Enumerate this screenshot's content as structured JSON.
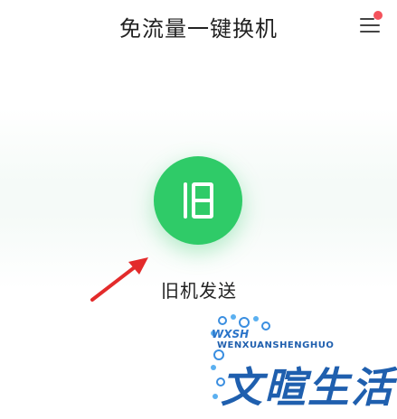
{
  "header": {
    "title": "免流量一键换机"
  },
  "menu": {
    "icon": "menu-icon",
    "badge_color": "#f4525c"
  },
  "old_phone": {
    "button_icon": "old-phone-icon",
    "button_color": "#2fcb68",
    "label": "旧机发送"
  },
  "annotation": {
    "arrow_icon": "red-arrow-icon",
    "arrow_color": "#e32b2b"
  },
  "watermark": {
    "script_text": "WXSH",
    "sub_text": "WENXUANSHENGHUO",
    "main_text": "文暄生活",
    "color": "#1f5fae"
  }
}
